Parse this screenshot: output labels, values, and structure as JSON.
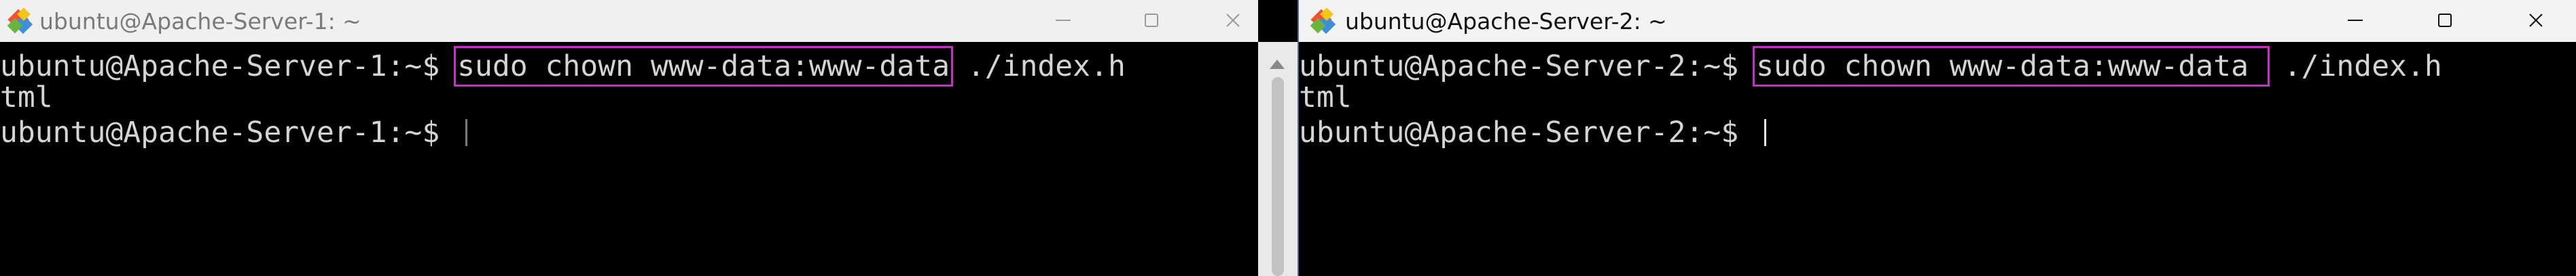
{
  "windows": [
    {
      "title": "ubuntu@Apache-Server-1: ~",
      "icon": "git-bash-icon",
      "controls": [
        "minimize",
        "maximize",
        "close"
      ],
      "terminal": {
        "line1": {
          "prompt": "ubuntu@Apache-Server-1:~$ ",
          "command_highlighted": "sudo chown www-data:www-data",
          "command_rest": " ./index.h"
        },
        "line2": "tml",
        "line3": {
          "prompt": "ubuntu@Apache-Server-1:~$ "
        }
      }
    },
    {
      "title": "ubuntu@Apache-Server-2: ~",
      "icon": "git-bash-icon",
      "controls": [
        "minimize",
        "maximize",
        "close"
      ],
      "terminal": {
        "line1": {
          "prompt": "ubuntu@Apache-Server-2:~$ ",
          "command_highlighted": "sudo chown www-data:www-data ",
          "command_rest": " ./index.h"
        },
        "line2": "tml",
        "line3": {
          "prompt": "ubuntu@Apache-Server-2:~$ "
        }
      }
    }
  ],
  "colors": {
    "terminal_bg": "#000000",
    "terminal_fg": "#d4d4d4",
    "highlight_border": "#c62fc6",
    "titlebar_bg": "#f3f3f3"
  }
}
